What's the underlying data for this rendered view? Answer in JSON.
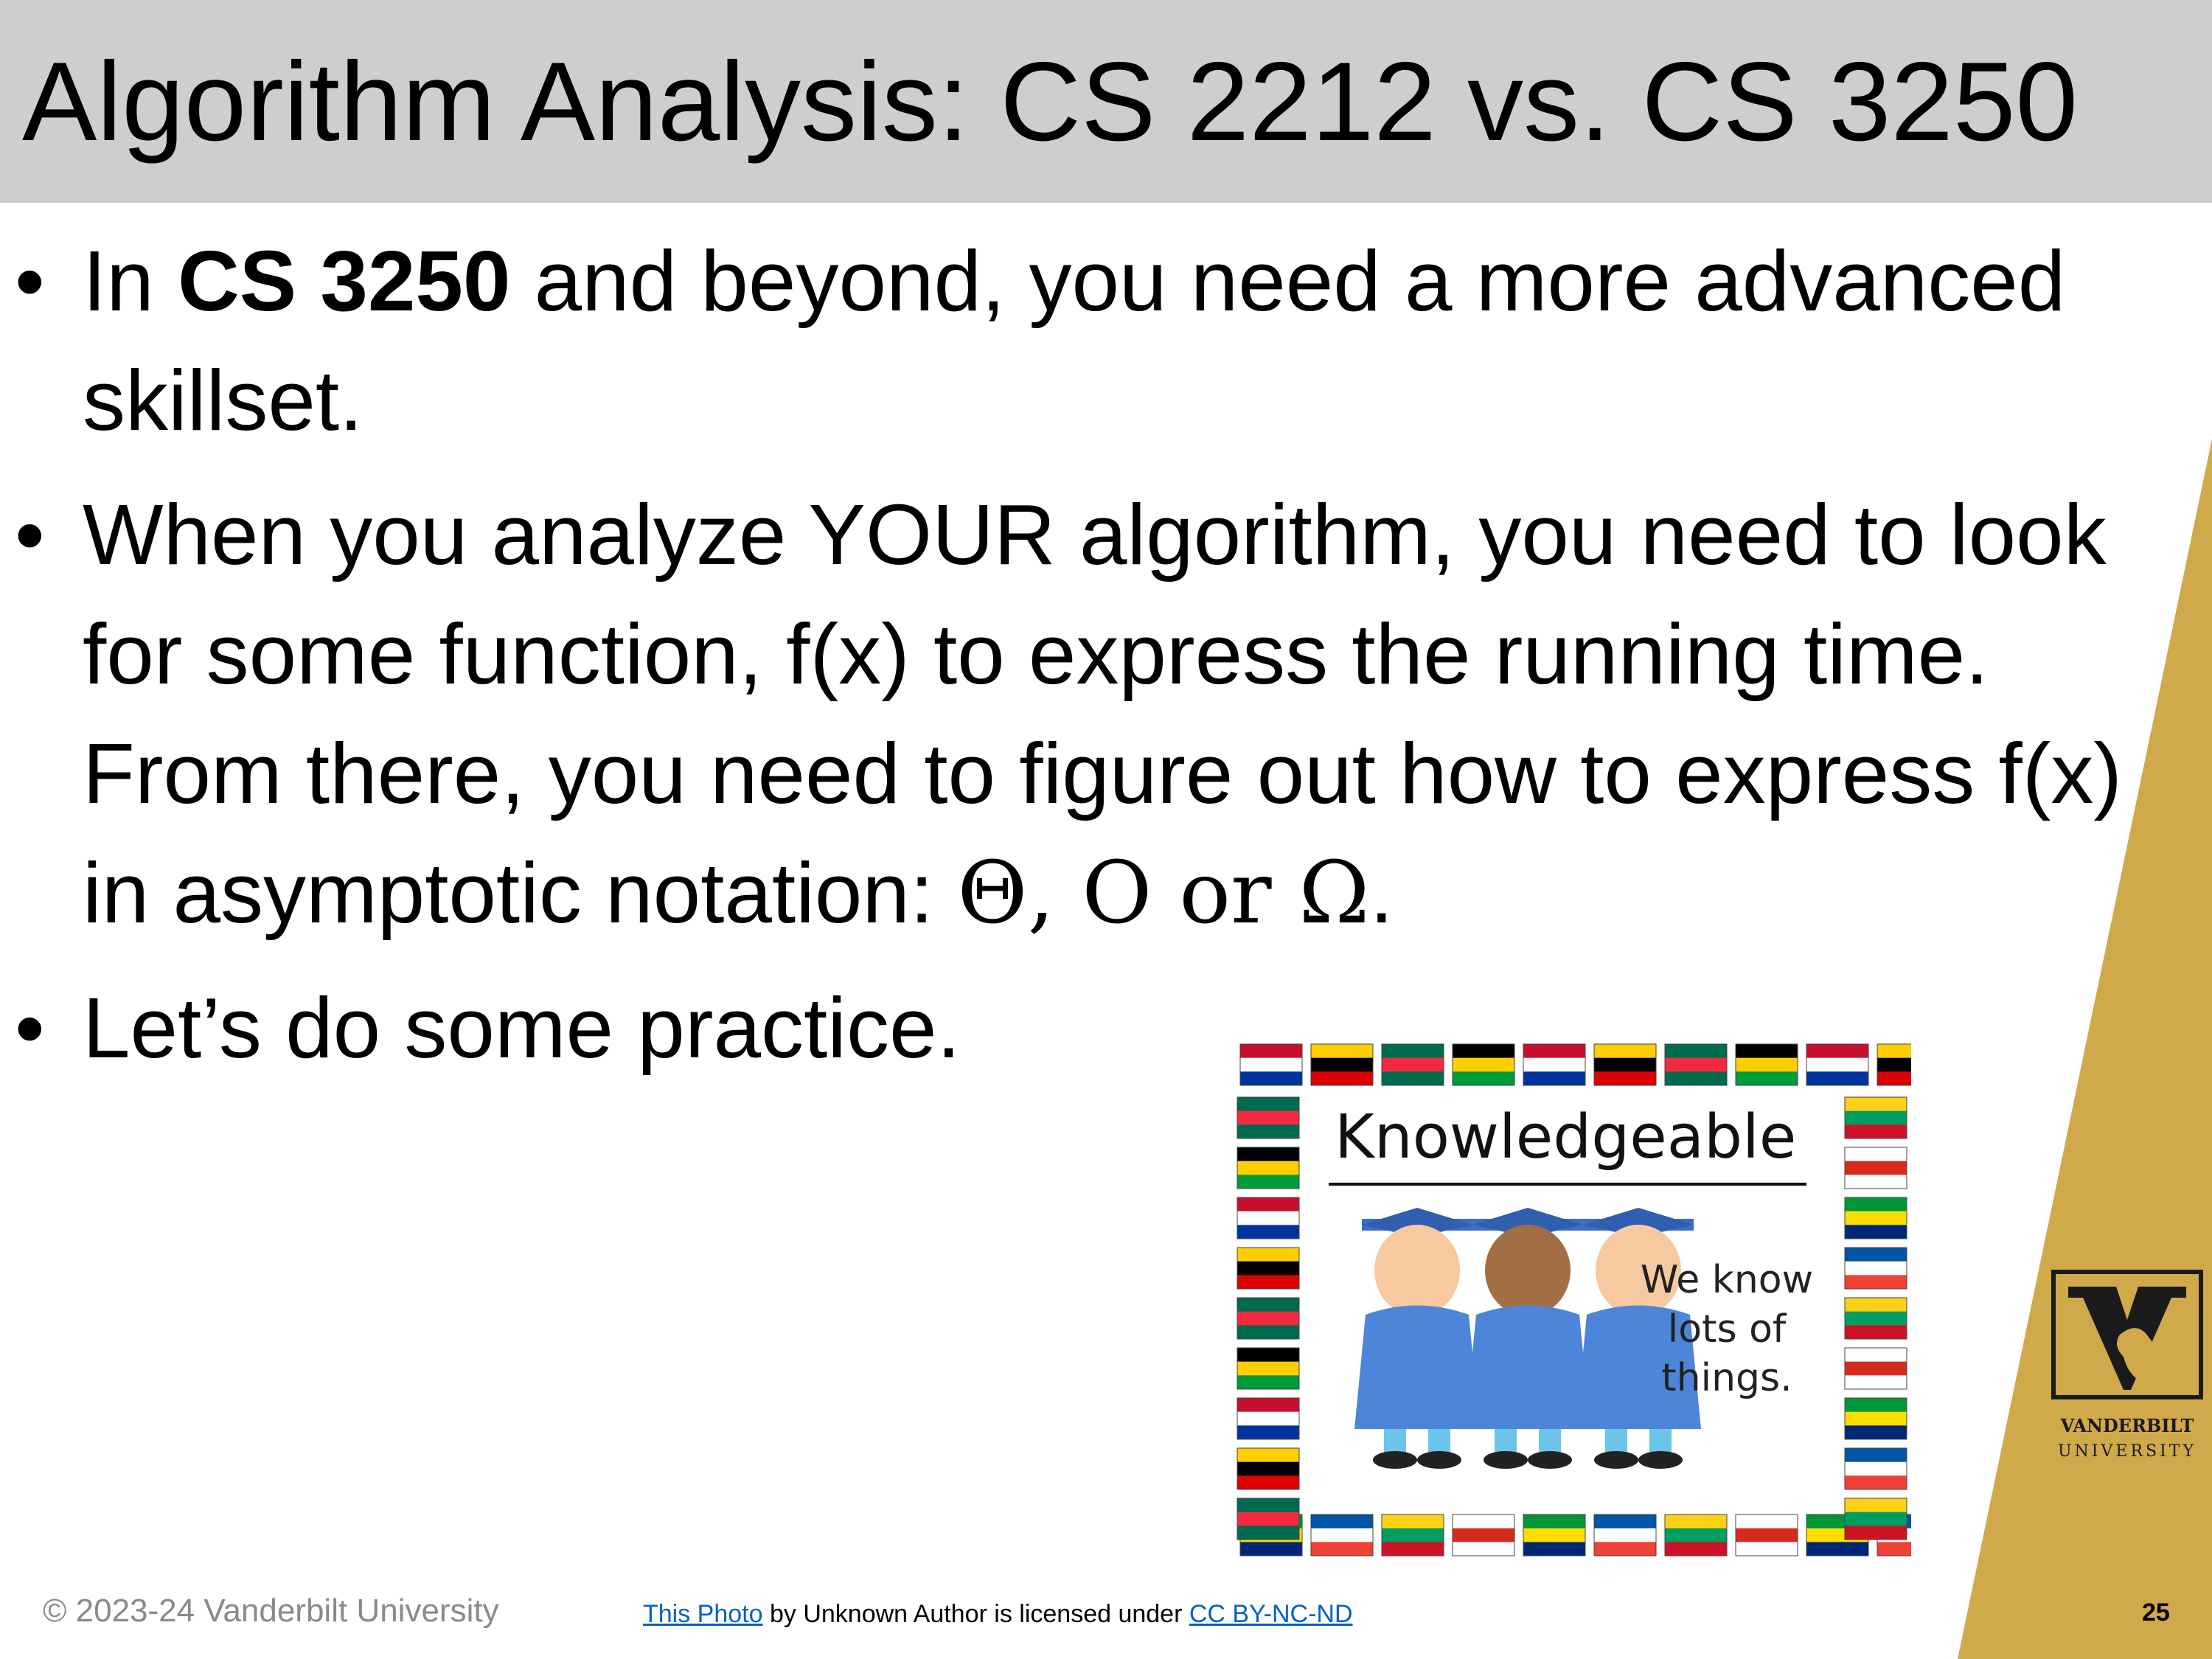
{
  "slide": {
    "title": "Algorithm Analysis: CS 2212 vs. CS 3250",
    "bullets": [
      {
        "pre": "In ",
        "bold": "CS 3250",
        "post": " and beyond, you need a more advanced skillset."
      },
      {
        "text": "When you analyze YOUR algorithm, you need to look for some function, f(x) to express the running time. From there, you need to figure out how to express f(x) in asymptotic notation: ",
        "math": "Θ, O or Ω",
        "end": "."
      },
      {
        "text": "Let’s do some practice."
      }
    ],
    "bullet_symbol": "•"
  },
  "image": {
    "heading": "Knowledgeable",
    "caption_lines": [
      "We know",
      "lots of",
      "things."
    ],
    "icon": "graduates-with-flags-border"
  },
  "logo": {
    "icon": "vanderbilt-v-oak-leaf-icon",
    "line1": "VANDERBILT",
    "line2": "UNIVERSITY"
  },
  "footer": {
    "copyright": "© 2023-24 Vanderbilt University",
    "attribution": {
      "link1": "This Photo",
      "middle": " by Unknown Author is licensed under ",
      "link2": "CC BY-NC-ND"
    },
    "page_number": "25"
  },
  "colors": {
    "title_bar": "#cfcdce",
    "gold": "#cfa94a",
    "link": "#0563c1",
    "footer_gray": "#8a8a8a"
  }
}
